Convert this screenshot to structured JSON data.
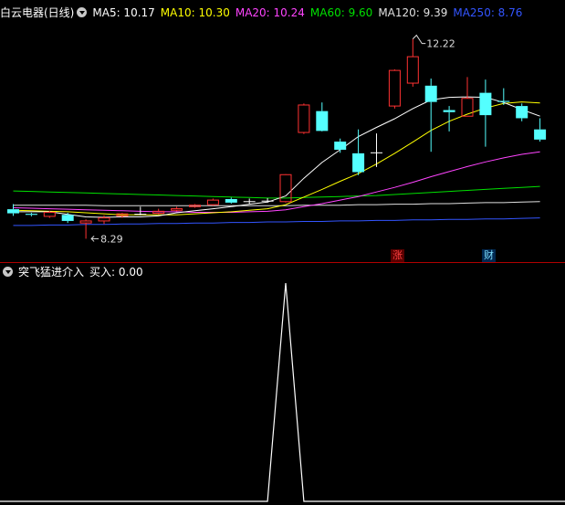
{
  "header": {
    "title": "白云电器(日线)",
    "ma": [
      {
        "label": "MA5: 10.17",
        "color": "#ffffff"
      },
      {
        "label": "MA10: 10.30",
        "color": "#ffff00"
      },
      {
        "label": "MA20: 10.24",
        "color": "#ff44ff"
      },
      {
        "label": "MA60: 9.60",
        "color": "#00e000"
      },
      {
        "label": "MA120: 9.39",
        "color": "#e0e0e0"
      },
      {
        "label": "MA250: 8.76",
        "color": "#3355ff"
      }
    ]
  },
  "price_chart": {
    "high_label": "12.22",
    "low_label": "8.29",
    "candles": [
      {
        "o": 8.87,
        "c": 8.79,
        "h": 8.97,
        "l": 8.74
      },
      {
        "o": 8.78,
        "c": 8.76,
        "h": 8.8,
        "l": 8.73
      },
      {
        "o": 8.73,
        "c": 8.81,
        "h": 8.84,
        "l": 8.7
      },
      {
        "o": 8.76,
        "c": 8.64,
        "h": 8.8,
        "l": 8.6
      },
      {
        "o": 8.6,
        "c": 8.64,
        "h": 8.67,
        "l": 8.29
      },
      {
        "o": 8.64,
        "c": 8.7,
        "h": 8.75,
        "l": 8.58
      },
      {
        "o": 8.74,
        "c": 8.78,
        "h": 8.8,
        "l": 8.7
      },
      {
        "o": 8.77,
        "c": 8.77,
        "h": 8.92,
        "l": 8.75
      },
      {
        "o": 8.79,
        "c": 8.83,
        "h": 8.88,
        "l": 8.77
      },
      {
        "o": 8.85,
        "c": 8.88,
        "h": 8.92,
        "l": 8.83
      },
      {
        "o": 8.92,
        "c": 8.95,
        "h": 8.97,
        "l": 8.9
      },
      {
        "o": 8.96,
        "c": 9.05,
        "h": 9.08,
        "l": 8.94
      },
      {
        "o": 9.07,
        "c": 9.0,
        "h": 9.1,
        "l": 8.98
      },
      {
        "o": 9.02,
        "c": 9.02,
        "h": 9.08,
        "l": 8.98
      },
      {
        "o": 9.03,
        "c": 9.03,
        "h": 9.09,
        "l": 9.0
      },
      {
        "o": 9.02,
        "c": 9.55,
        "h": 9.56,
        "l": 9.0
      },
      {
        "o": 10.38,
        "c": 10.92,
        "h": 10.95,
        "l": 10.35
      },
      {
        "o": 10.8,
        "c": 10.41,
        "h": 10.97,
        "l": 10.4
      },
      {
        "o": 10.2,
        "c": 10.04,
        "h": 10.26,
        "l": 9.98
      },
      {
        "o": 9.97,
        "c": 9.6,
        "h": 10.44,
        "l": 9.54
      },
      {
        "o": 9.98,
        "c": 9.98,
        "h": 10.36,
        "l": 9.7
      },
      {
        "o": 10.9,
        "c": 11.6,
        "h": 11.62,
        "l": 10.85
      },
      {
        "o": 11.35,
        "c": 11.87,
        "h": 12.22,
        "l": 11.28
      },
      {
        "o": 11.3,
        "c": 10.98,
        "h": 11.44,
        "l": 10.0
      },
      {
        "o": 10.82,
        "c": 10.78,
        "h": 10.9,
        "l": 10.4
      },
      {
        "o": 10.7,
        "c": 11.05,
        "h": 11.47,
        "l": 10.7
      },
      {
        "o": 11.16,
        "c": 10.72,
        "h": 11.42,
        "l": 10.1
      },
      {
        "o": 11.0,
        "c": 10.98,
        "h": 11.25,
        "l": 10.92
      },
      {
        "o": 10.9,
        "c": 10.66,
        "h": 10.95,
        "l": 10.6
      },
      {
        "o": 10.44,
        "c": 10.24,
        "h": 10.66,
        "l": 10.2
      }
    ],
    "ma5": [
      8.82,
      8.82,
      8.82,
      8.77,
      8.72,
      8.71,
      8.72,
      8.72,
      8.74,
      8.8,
      8.84,
      8.88,
      8.92,
      8.97,
      9.01,
      9.13,
      9.48,
      9.79,
      10.04,
      10.3,
      10.48,
      10.65,
      10.85,
      11.02,
      11.07,
      11.08,
      11.07,
      10.97,
      10.83,
      10.7
    ],
    "ma10": [
      8.85,
      8.84,
      8.83,
      8.82,
      8.8,
      8.78,
      8.76,
      8.76,
      8.76,
      8.76,
      8.78,
      8.8,
      8.82,
      8.85,
      8.88,
      8.96,
      9.11,
      9.26,
      9.42,
      9.57,
      9.76,
      9.97,
      10.19,
      10.42,
      10.6,
      10.74,
      10.86,
      10.95,
      10.98,
      10.96
    ],
    "ma20": [
      8.9,
      8.89,
      8.88,
      8.87,
      8.86,
      8.85,
      8.84,
      8.83,
      8.82,
      8.82,
      8.81,
      8.81,
      8.81,
      8.82,
      8.83,
      8.86,
      8.92,
      8.98,
      9.05,
      9.12,
      9.21,
      9.3,
      9.4,
      9.51,
      9.61,
      9.71,
      9.8,
      9.88,
      9.95,
      10.0
    ],
    "ma60": [
      9.23,
      9.22,
      9.21,
      9.2,
      9.19,
      9.18,
      9.17,
      9.16,
      9.15,
      9.14,
      9.13,
      9.12,
      9.11,
      9.1,
      9.09,
      9.09,
      9.1,
      9.11,
      9.12,
      9.13,
      9.14,
      9.16,
      9.18,
      9.2,
      9.22,
      9.24,
      9.26,
      9.28,
      9.3,
      9.32
    ],
    "ma120": [
      8.95,
      8.95,
      8.95,
      8.95,
      8.95,
      8.94,
      8.94,
      8.94,
      8.94,
      8.94,
      8.94,
      8.94,
      8.94,
      8.94,
      8.94,
      8.94,
      8.95,
      8.95,
      8.95,
      8.96,
      8.96,
      8.97,
      8.97,
      8.98,
      8.98,
      8.99,
      9.0,
      9.0,
      9.01,
      9.02
    ],
    "ma250": [
      8.55,
      8.55,
      8.56,
      8.56,
      8.57,
      8.57,
      8.58,
      8.58,
      8.59,
      8.59,
      8.6,
      8.6,
      8.61,
      8.61,
      8.62,
      8.62,
      8.63,
      8.63,
      8.64,
      8.64,
      8.65,
      8.65,
      8.66,
      8.66,
      8.67,
      8.67,
      8.68,
      8.68,
      8.69,
      8.7
    ],
    "ylim": [
      8.1,
      12.5
    ]
  },
  "badges": {
    "zhang": "涨",
    "cai": "财"
  },
  "indicator": {
    "title": "突飞猛进介入",
    "value_label": "买入: 0.00",
    "signal": [
      0,
      0,
      0,
      0,
      0,
      0,
      0,
      0,
      0,
      0,
      0,
      0,
      0,
      0,
      0,
      1,
      0,
      0,
      0,
      0,
      0,
      0,
      0,
      0,
      0,
      0,
      0,
      0,
      0,
      0
    ],
    "ylim": [
      0,
      1
    ]
  },
  "colors": {
    "up": "#ff3232",
    "down": "#54ffff",
    "neutral": "#ffffff",
    "axis": "#b00000"
  }
}
